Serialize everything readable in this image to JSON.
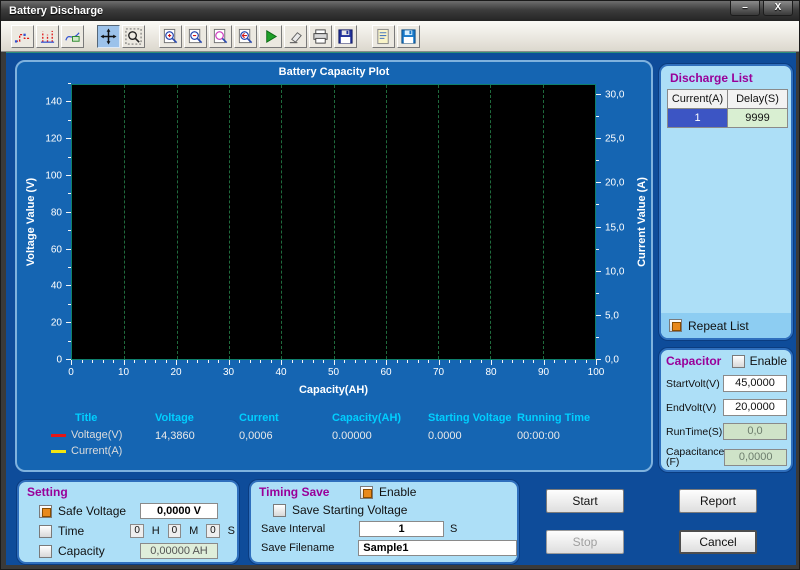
{
  "window": {
    "title": "Battery Discharge",
    "minimize": "–",
    "close": "X"
  },
  "toolbar": {
    "buttons": [
      "plot-style-step",
      "plot-style-bars",
      "plot-style-curve",
      "pan",
      "zoom-region",
      "zoom-in",
      "zoom-out",
      "zoom-window",
      "zoom-reset",
      "run",
      "erase",
      "print",
      "save",
      "report-file",
      "save-data"
    ]
  },
  "chart_data": {
    "type": "line",
    "title": "Battery Capacity Plot",
    "plot_bg": "#000000",
    "grid": {
      "vertical_dashed": true,
      "color": "#1f6a3c"
    },
    "x": {
      "label": "Capacity(AH)",
      "min": 0,
      "max": 100,
      "major": 10,
      "minor": 2,
      "ticks": [
        0,
        10,
        20,
        30,
        40,
        50,
        60,
        70,
        80,
        90,
        100
      ]
    },
    "y_left": {
      "label": "Voltage Value (V)",
      "min": 0,
      "max": 150,
      "major": 20,
      "minor": 10,
      "ticks": [
        0,
        20,
        40,
        60,
        80,
        100,
        120,
        140
      ]
    },
    "y_right": {
      "label": "Current Value (A)",
      "min": 0,
      "max": 31.25,
      "major": 5,
      "minor": 2.5,
      "ticks": [
        "0,0",
        "5,0",
        "10,0",
        "15,0",
        "20,0",
        "25,0",
        "30,0"
      ]
    },
    "series": [
      {
        "name": "Voltage(V)",
        "color": "#e51616",
        "values": []
      },
      {
        "name": "Current(A)",
        "color": "#f2e410",
        "values": []
      }
    ]
  },
  "legend": {
    "headers": [
      "Title",
      "Voltage",
      "Current",
      "Capacity(AH)",
      "Starting Voltage",
      "Running Time"
    ],
    "series_labels": [
      "Voltage(V)",
      "Current(A)"
    ],
    "values": [
      "14,3860",
      "0,0006",
      "0.00000",
      "0.0000",
      "00:00:00"
    ]
  },
  "discharge_list": {
    "title": "Discharge List",
    "columns": [
      "Current(A)",
      "Delay(S)"
    ],
    "rows": [
      [
        "1",
        "9999"
      ]
    ],
    "repeat_label": "Repeat List",
    "repeat_checked": true
  },
  "capacitor": {
    "title": "Capacitor",
    "enable_label": "Enable",
    "enable_checked": false,
    "fields": [
      {
        "label": "StartVolt(V)",
        "value": "45,0000",
        "disabled": false
      },
      {
        "label": "EndVolt(V)",
        "value": "20,0000",
        "disabled": false
      },
      {
        "label": "RunTime(S)",
        "value": "0,0",
        "disabled": true
      },
      {
        "label": "Capacitance (F)",
        "value": "0,0000",
        "disabled": true
      }
    ]
  },
  "setting": {
    "title": "Setting",
    "safe_voltage": {
      "label": "Safe Voltage",
      "checked": true,
      "value": "0,0000 V"
    },
    "time": {
      "label": "Time",
      "checked": false,
      "h": "0",
      "m": "0",
      "s": "0",
      "h_label": "H",
      "m_label": "M",
      "s_label": "S"
    },
    "capacity": {
      "label": "Capacity",
      "checked": false,
      "value": "0,00000 AH"
    }
  },
  "timing_save": {
    "title": "Timing Save",
    "enable_label": "Enable",
    "enable_checked": true,
    "save_starting_voltage": {
      "label": "Save Starting Voltage",
      "checked": false
    },
    "save_interval": {
      "label": "Save Interval",
      "value": "1",
      "unit": "S"
    },
    "save_filename": {
      "label": "Save Filename",
      "value": "Sample1"
    }
  },
  "buttons": {
    "start": "Start",
    "report": "Report",
    "stop": "Stop",
    "cancel": "Cancel"
  }
}
